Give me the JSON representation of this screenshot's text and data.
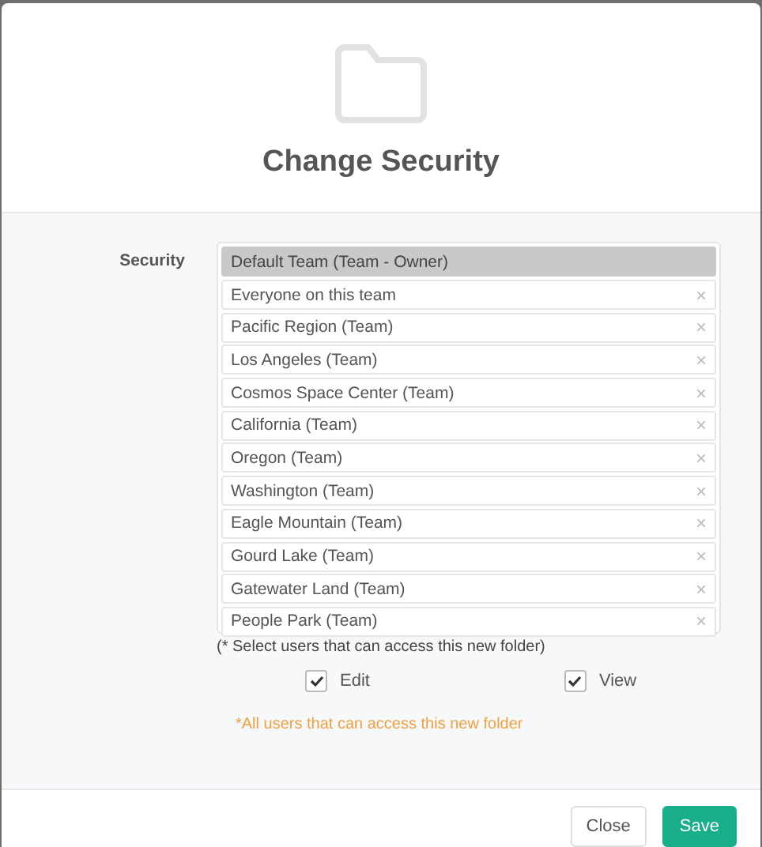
{
  "dialog": {
    "title": "Change Security"
  },
  "security": {
    "label": "Security",
    "items": [
      {
        "label": "Default Team (Team - Owner)",
        "selected": true,
        "removable": false
      },
      {
        "label": "Everyone on this team",
        "selected": false,
        "removable": true
      },
      {
        "label": "Pacific Region (Team)",
        "selected": false,
        "removable": true
      },
      {
        "label": "Los Angeles (Team)",
        "selected": false,
        "removable": true
      },
      {
        "label": "Cosmos Space Center (Team)",
        "selected": false,
        "removable": true
      },
      {
        "label": "California (Team)",
        "selected": false,
        "removable": true
      },
      {
        "label": "Oregon (Team)",
        "selected": false,
        "removable": true
      },
      {
        "label": "Washington (Team)",
        "selected": false,
        "removable": true
      },
      {
        "label": "Eagle Mountain (Team)",
        "selected": false,
        "removable": true
      },
      {
        "label": "Gourd Lake (Team)",
        "selected": false,
        "removable": true
      },
      {
        "label": "Gatewater Land (Team)",
        "selected": false,
        "removable": true
      },
      {
        "label": "People Park (Team)",
        "selected": false,
        "removable": true
      }
    ],
    "remove_glyph": "×",
    "hint": "(* Select users that can access this new folder)",
    "permissions": [
      {
        "label": "Edit",
        "checked": true
      },
      {
        "label": "View",
        "checked": true
      }
    ],
    "note": "*All users that can access this new folder"
  },
  "buttons": [
    {
      "label": "Close",
      "kind": "secondary"
    },
    {
      "label": "Save",
      "kind": "primary"
    }
  ]
}
